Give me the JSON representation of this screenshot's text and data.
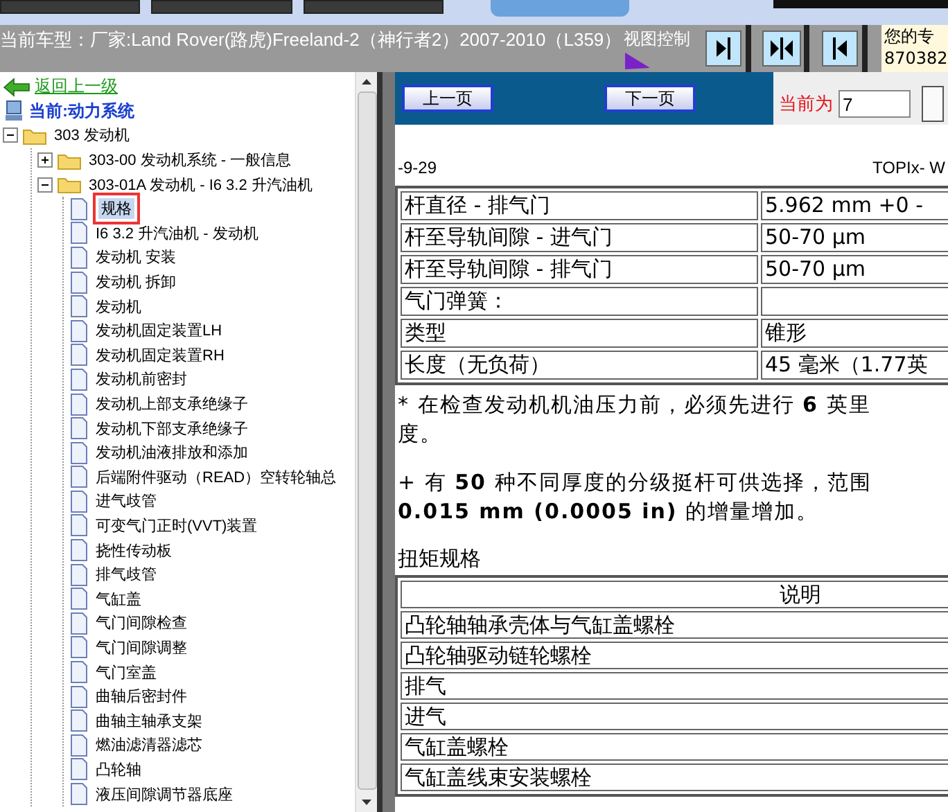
{
  "header": {
    "vehicle": "当前车型：厂家:Land Rover(路虎)Freeland-2（神行者2）2007-2010（L359）",
    "view_control_label": "视图控制",
    "info_lines": [
      "您的专",
      "870382"
    ]
  },
  "nav": {
    "back_link": "返回上一级",
    "current": "当前:动力系统"
  },
  "tree": [
    {
      "label": "303 发动机",
      "kind": "folder",
      "expanded": true,
      "children": [
        {
          "label": "303-00 发动机系统 - 一般信息",
          "kind": "folder",
          "expanded": false
        },
        {
          "label": "303-01A 发动机 - I6 3.2 升汽油机",
          "kind": "folder",
          "expanded": true,
          "children": [
            {
              "label": "规格",
              "kind": "page",
              "selected": true
            },
            {
              "label": "I6 3.2 升汽油机 - 发动机",
              "kind": "page",
              "selected": false
            },
            {
              "label": "发动机 安装",
              "kind": "page",
              "selected": false
            },
            {
              "label": "发动机 拆卸",
              "kind": "page",
              "selected": false
            },
            {
              "label": "发动机",
              "kind": "page",
              "selected": false
            },
            {
              "label": "发动机固定装置LH",
              "kind": "page",
              "selected": false
            },
            {
              "label": "发动机固定装置RH",
              "kind": "page",
              "selected": false
            },
            {
              "label": "发动机前密封",
              "kind": "page",
              "selected": false
            },
            {
              "label": "发动机上部支承绝缘子",
              "kind": "page",
              "selected": false
            },
            {
              "label": "发动机下部支承绝缘子",
              "kind": "page",
              "selected": false
            },
            {
              "label": "发动机油液排放和添加",
              "kind": "page",
              "selected": false
            },
            {
              "label": "后端附件驱动（READ）空转轮轴总",
              "kind": "page",
              "selected": false
            },
            {
              "label": "进气歧管",
              "kind": "page",
              "selected": false
            },
            {
              "label": "可变气门正时(VVT)装置",
              "kind": "page",
              "selected": false
            },
            {
              "label": "挠性传动板",
              "kind": "page",
              "selected": false
            },
            {
              "label": "排气歧管",
              "kind": "page",
              "selected": false
            },
            {
              "label": "气缸盖",
              "kind": "page",
              "selected": false
            },
            {
              "label": "气门间隙检查",
              "kind": "page",
              "selected": false
            },
            {
              "label": "气门间隙调整",
              "kind": "page",
              "selected": false
            },
            {
              "label": "气门室盖",
              "kind": "page",
              "selected": false
            },
            {
              "label": "曲轴后密封件",
              "kind": "page",
              "selected": false
            },
            {
              "label": "曲轴主轴承支架",
              "kind": "page",
              "selected": false
            },
            {
              "label": "燃油滤清器滤芯",
              "kind": "page",
              "selected": false
            },
            {
              "label": "凸轮轴",
              "kind": "page",
              "selected": false
            },
            {
              "label": "液压间隙调节器底座",
              "kind": "page",
              "selected": false
            }
          ]
        }
      ]
    }
  ],
  "pager": {
    "prev": "上一页",
    "next": "下一页",
    "current_label": "当前为",
    "current_page": "7"
  },
  "document": {
    "date": "-9-29",
    "source": "TOPIx- W",
    "spec_rows": [
      [
        "杆直径 - 排气门",
        "5.962 mm +0 -"
      ],
      [
        "杆至导轨间隙 - 进气门",
        "50-70 μm"
      ],
      [
        "杆至导轨间隙 - 排气门",
        "50-70 μm"
      ],
      [
        "气门弹簧：",
        ""
      ],
      [
        "类型",
        "锥形"
      ],
      [
        "长度（无负荷）",
        "45 毫米（1.77英"
      ]
    ],
    "notes": [
      [
        "* 在检查发动机机油压力前，必须先进行 **6** 英里",
        "度。"
      ],
      [
        "+ 有 **50** 种不同厚度的分级挺杆可供选择，范围",
        "**0.015 mm (0.0005 in)** 的增量增加。"
      ]
    ],
    "torque_title": "扭矩规格",
    "torque_header": "说明",
    "torque_rows": [
      "凸轮轴轴承壳体与气缸盖螺栓",
      "凸轮轴驱动链轮螺栓",
      "排气",
      "进气",
      "气缸盖螺栓",
      "气缸盖线束安装螺栓"
    ]
  }
}
